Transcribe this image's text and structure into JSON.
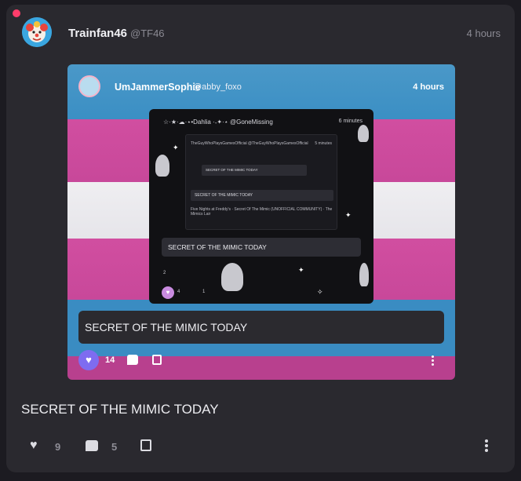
{
  "post": {
    "author_name": "Trainfan46",
    "author_handle": "@TF46",
    "time": "4 hours",
    "text": "SECRET OF THE MIMIC TODAY",
    "like_count": "9",
    "reply_count": "5",
    "icons": {
      "avatar": "clown-avatar",
      "notification": "notification-dot",
      "like": "heart-icon",
      "reply": "reply-icon",
      "share": "share-icon",
      "more": "more-vertical-icon"
    }
  },
  "embed": {
    "author_name": "UmJammerSophie",
    "author_handle": "@abby_foxo",
    "time": "4 hours",
    "text": "SECRET OF THE MIMIC TODAY",
    "like_count": "14",
    "like_button_color": "#7e6cf0",
    "background": "trans-pride-flag",
    "nested": {
      "header": "☆·★·☁·⋆•Dahlia ·˖✦·⋆ @GoneMissing",
      "time": "6 minutes",
      "inner_title": "TheGuyWhoPlaysGamesOfficial @TheGuyWhoPlaysGamesOfficial",
      "inner_time": "5 minutes",
      "mini_box_text": "SECRET OF THE MIMIC TODAY",
      "inner_box_text": "SECRET OF THE MIMIC TODAY",
      "inner_tags": "Five Nights at Freddy's · Secret Of The Mimic (UNOFFICIAL COMMUNITY) · The Mimics Lair",
      "box_text": "SECRET OF THE MIMIC TODAY",
      "like_count": "4",
      "reply_count": "1",
      "badge_count": "2"
    }
  }
}
